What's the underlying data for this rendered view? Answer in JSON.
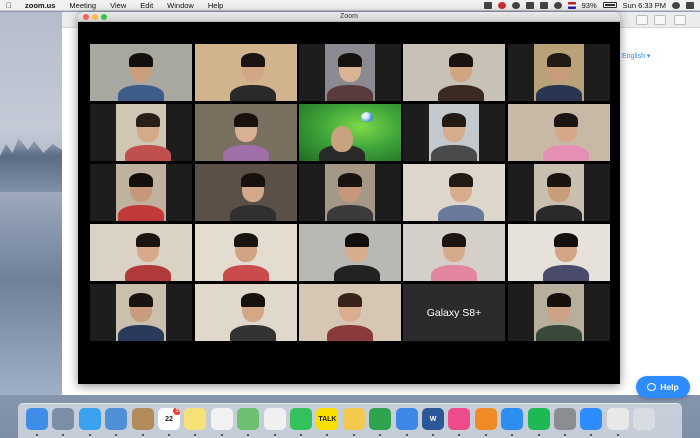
{
  "menubar": {
    "app_name": "zoom.us",
    "menus": [
      "Meeting",
      "View",
      "Edit",
      "Window",
      "Help"
    ],
    "battery": "93%",
    "clock": "Sun 6:33 PM"
  },
  "browser": {
    "language_link": "English ▾"
  },
  "help_button": {
    "label": "Help"
  },
  "zoom_window": {
    "title": "Zoom",
    "tiles": [
      {
        "kind": "person",
        "bg": "#a8a8a0",
        "skin": "#c89e7c",
        "hair": "#141010",
        "shirt": "#3c5d8a",
        "active": true
      },
      {
        "kind": "person",
        "bg": "#d2b48c",
        "skin": "#d2a786",
        "hair": "#1a1412",
        "shirt": "#2a2a2a"
      },
      {
        "kind": "person",
        "bg": "#8a8a90",
        "skin": "#d9b394",
        "hair": "#15110e",
        "shirt": "#5a3b3b",
        "bars": true
      },
      {
        "kind": "person",
        "bg": "#c8c2b6",
        "skin": "#cfa582",
        "hair": "#1a120e",
        "shirt": "#3a2a22"
      },
      {
        "kind": "person",
        "bg": "#b9a27a",
        "skin": "#c89d7a",
        "hair": "#221a14",
        "shirt": "#2a3552",
        "bars": true
      },
      {
        "kind": "person",
        "bg": "#cfc6b4",
        "skin": "#d4aa88",
        "hair": "#2a1f18",
        "shirt": "#c0504d",
        "bars": true
      },
      {
        "kind": "person",
        "bg": "#7a7060",
        "skin": "#d8b092",
        "hair": "#18110d",
        "shirt": "#9e6fa8"
      },
      {
        "kind": "nature",
        "bg": "#3fa63a"
      },
      {
        "kind": "person",
        "bg": "#c2c8cc",
        "skin": "#d6ad8c",
        "hair": "#241a14",
        "shirt": "#4a4a4a",
        "bars": true
      },
      {
        "kind": "person",
        "bg": "#c8b9a6",
        "skin": "#d4a888",
        "hair": "#1d1512",
        "shirt": "#e58fb5"
      },
      {
        "kind": "person",
        "bg": "#bfb2a0",
        "skin": "#c59878",
        "hair": "#15100c",
        "shirt": "#c03a3a",
        "bars": true
      },
      {
        "kind": "person",
        "bg": "#5a5048",
        "skin": "#d2a98a",
        "hair": "#17110e",
        "shirt": "#303030"
      },
      {
        "kind": "person",
        "bg": "#a59886",
        "skin": "#c6977a",
        "hair": "#1a1410",
        "shirt": "#3b3b3b",
        "bars": true
      },
      {
        "kind": "person",
        "bg": "#ddd6ca",
        "skin": "#d6ac8c",
        "hair": "#241a14",
        "shirt": "#6a7a9a"
      },
      {
        "kind": "person",
        "bg": "#c9bfae",
        "skin": "#c99c7a",
        "hair": "#1a1410",
        "shirt": "#2a2a2a",
        "bars": true
      },
      {
        "kind": "person",
        "bg": "#d9d2c5",
        "skin": "#d6aa8a",
        "hair": "#1c1410",
        "shirt": "#b23a3a"
      },
      {
        "kind": "person",
        "bg": "#e3dccf",
        "skin": "#d0a383",
        "hair": "#1a1410",
        "shirt": "#c94b4b"
      },
      {
        "kind": "person",
        "bg": "#b8b8b4",
        "skin": "#d7ad8c",
        "hair": "#120e0b",
        "shirt": "#222222"
      },
      {
        "kind": "person",
        "bg": "#d4cfc8",
        "skin": "#d6ab8b",
        "hair": "#1c1410",
        "shirt": "#e2869f"
      },
      {
        "kind": "person",
        "bg": "#e6e2da",
        "skin": "#d2a686",
        "hair": "#15100c",
        "shirt": "#4a4a6a"
      },
      {
        "kind": "person",
        "bg": "#cbbfae",
        "skin": "#c99c7b",
        "hair": "#1a1410",
        "shirt": "#2a3a5a",
        "bars": true
      },
      {
        "kind": "person",
        "bg": "#e0d8cb",
        "skin": "#d3a887",
        "hair": "#17110e",
        "shirt": "#333333"
      },
      {
        "kind": "person",
        "bg": "#d5c7b4",
        "skin": "#d8ae8e",
        "hair": "#3a241a",
        "shirt": "#8a3a3a"
      },
      {
        "kind": "label",
        "bg": "#2b2b2b",
        "text": "Galaxy S8+"
      },
      {
        "kind": "person",
        "bg": "#b8ae9c",
        "skin": "#cfa283",
        "hair": "#15100c",
        "shirt": "#3a4a3a",
        "bars": true
      }
    ]
  },
  "dock": {
    "icons": [
      {
        "name": "finder-icon",
        "color": "#3e8ee8"
      },
      {
        "name": "launchpad-icon",
        "color": "#7a8ea8"
      },
      {
        "name": "safari-icon",
        "color": "#3aa0f0"
      },
      {
        "name": "mail-icon",
        "color": "#4f8fd6"
      },
      {
        "name": "contacts-icon",
        "color": "#b38a5a"
      },
      {
        "name": "calendar-icon",
        "color": "#ffffff",
        "text": "22",
        "badge": "1"
      },
      {
        "name": "notes-icon",
        "color": "#f7e27a"
      },
      {
        "name": "reminders-icon",
        "color": "#f2f2f2"
      },
      {
        "name": "maps-icon",
        "color": "#6cc070"
      },
      {
        "name": "photos-icon",
        "color": "#f0f0f0"
      },
      {
        "name": "messages-icon",
        "color": "#32c15a"
      },
      {
        "name": "kakaotalk-icon",
        "color": "#f9e000",
        "text": "TALK"
      },
      {
        "name": "stickies-icon",
        "color": "#f2c94c"
      },
      {
        "name": "numbers-icon",
        "color": "#2fa44f"
      },
      {
        "name": "keynote-icon",
        "color": "#3f87e6"
      },
      {
        "name": "word-icon",
        "color": "#2b5797",
        "text": "W"
      },
      {
        "name": "itunes-icon",
        "color": "#ee4b8a"
      },
      {
        "name": "books-icon",
        "color": "#f08a24"
      },
      {
        "name": "app-store-icon",
        "color": "#2d8ef0"
      },
      {
        "name": "spotify-icon",
        "color": "#1db954"
      },
      {
        "name": "system-preferences-icon",
        "color": "#8a8d92"
      },
      {
        "name": "zoom-icon",
        "color": "#2d8cff"
      },
      {
        "name": "chrome-icon",
        "color": "#e8e8e8"
      },
      {
        "name": "trash-icon",
        "color": "#d8dde4"
      }
    ]
  }
}
